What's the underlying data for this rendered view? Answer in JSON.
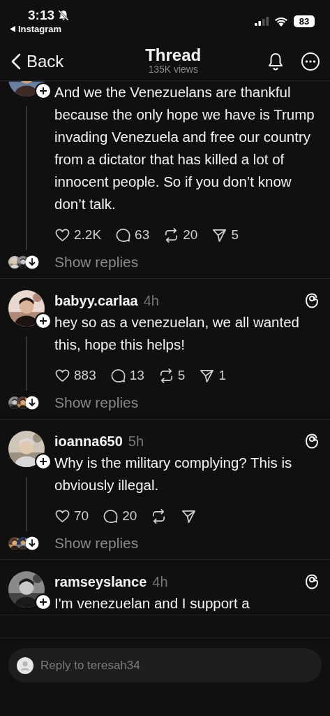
{
  "status_bar": {
    "time": "3:13",
    "back_app": "Instagram",
    "battery": "83"
  },
  "header": {
    "back": "Back",
    "title": "Thread",
    "subtitle": "135K views"
  },
  "posts": [
    {
      "text": "And we the Venezuelans are thankful because the only hope we have is Trump invading Venezuela and free our country from a dictator that has killed a lot of innocent people. So if you don’t know don’t talk.",
      "likes": "2.2K",
      "comments": "63",
      "reposts": "20",
      "shares": "5",
      "show_replies": "Show replies"
    },
    {
      "username": "babyy.carlaa",
      "time": "4h",
      "text": "hey so as a venezuelan, we all wanted this, hope this helps!",
      "likes": "883",
      "comments": "13",
      "reposts": "5",
      "shares": "1",
      "show_replies": "Show replies"
    },
    {
      "username": "ioanna650",
      "time": "5h",
      "text": "Why is the military complying? This is obviously illegal.",
      "likes": "70",
      "comments": "20",
      "show_replies": "Show replies"
    },
    {
      "username": "ramseyslance",
      "time": "4h",
      "text": "I'm venezuelan and I support a"
    }
  ],
  "reply_bar": {
    "placeholder": "Reply to teresah34"
  }
}
